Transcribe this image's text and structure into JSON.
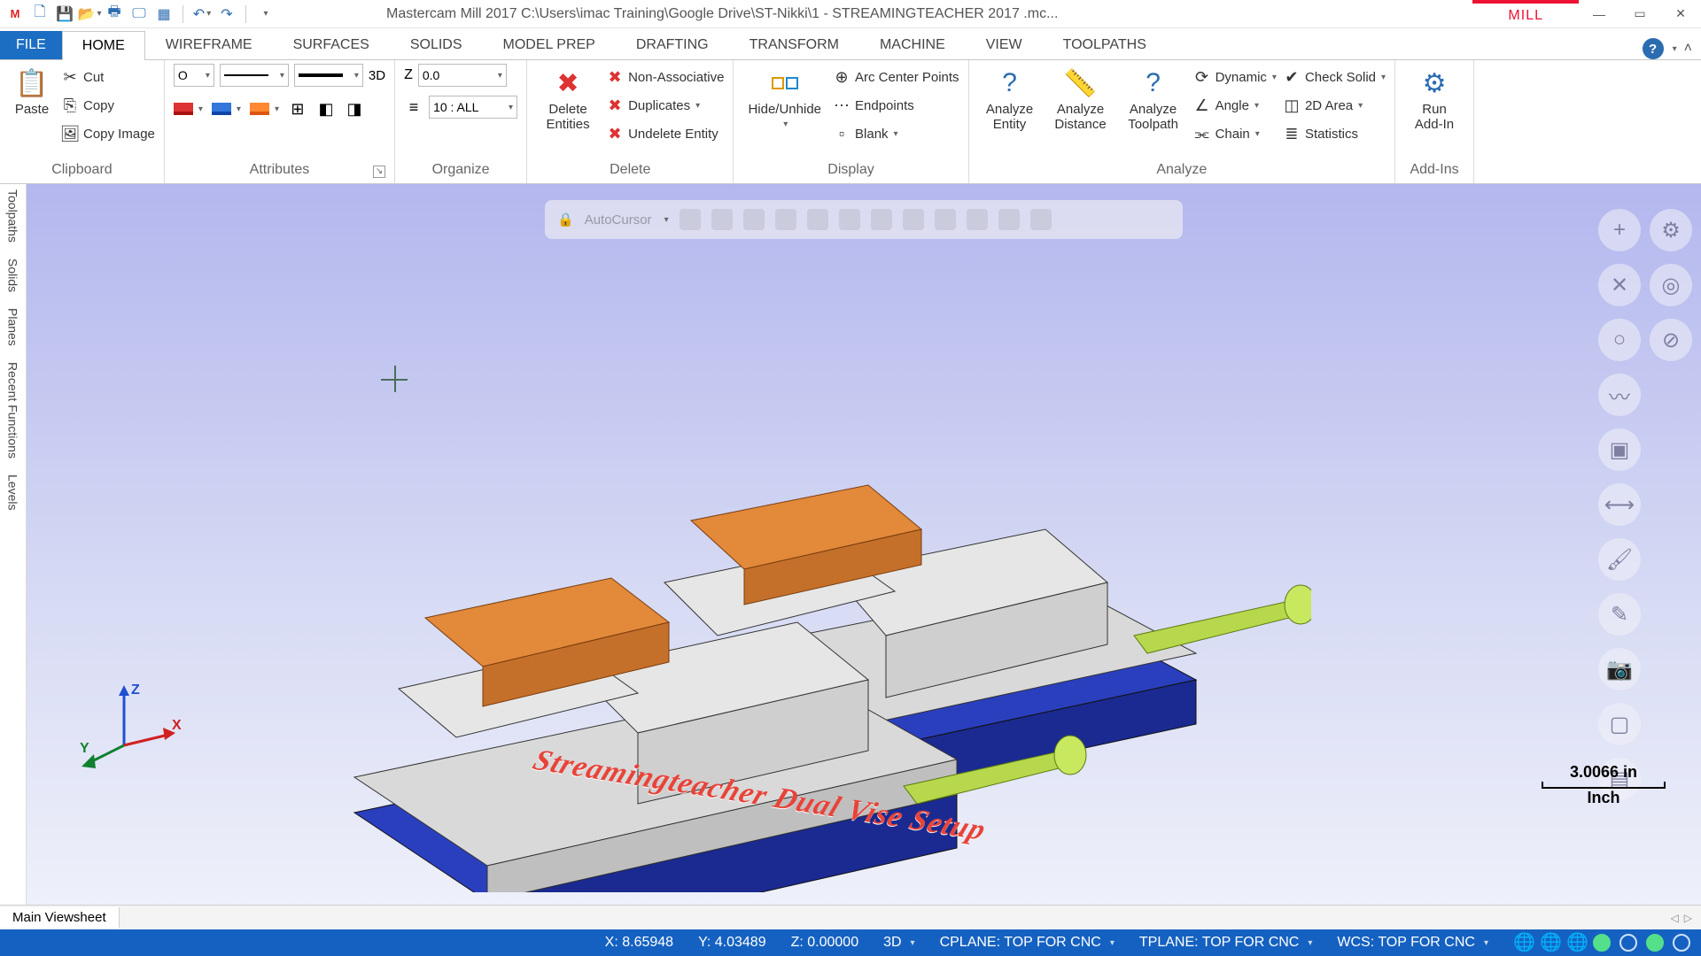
{
  "title": "Mastercam Mill 2017   C:\\Users\\imac Training\\Google Drive\\ST-Nikki\\1 - STREAMINGTEACHER 2017 .mc...",
  "context_tab": "MILL",
  "tabs": {
    "file": "FILE",
    "list": [
      "HOME",
      "WIREFRAME",
      "SURFACES",
      "SOLIDS",
      "MODEL PREP",
      "DRAFTING",
      "TRANSFORM",
      "MACHINE",
      "VIEW",
      "TOOLPATHS"
    ],
    "active": "HOME"
  },
  "ribbon": {
    "clipboard": {
      "label": "Clipboard",
      "paste": "Paste",
      "cut": "Cut",
      "copy": "Copy",
      "copy_image": "Copy Image"
    },
    "attributes": {
      "label": "Attributes",
      "point_style": "O",
      "threeD": "3D"
    },
    "organize": {
      "label": "Organize",
      "z_label": "Z",
      "z_value": "0.0",
      "level_value": "10 : ALL"
    },
    "delete": {
      "label": "Delete",
      "delete_entities": "Delete Entities",
      "non_assoc": "Non-Associative",
      "duplicates": "Duplicates",
      "undelete": "Undelete Entity"
    },
    "display": {
      "label": "Display",
      "hide_unhide": "Hide/Unhide",
      "arc_center": "Arc Center Points",
      "endpoints": "Endpoints",
      "blank": "Blank"
    },
    "analyze": {
      "label": "Analyze",
      "entity": "Analyze Entity",
      "distance": "Analyze Distance",
      "toolpath": "Analyze Toolpath",
      "dynamic": "Dynamic",
      "angle": "Angle",
      "chain": "Chain",
      "check_solid": "Check Solid",
      "area": "2D Area",
      "statistics": "Statistics"
    },
    "addins": {
      "label": "Add-Ins",
      "run": "Run Add-In"
    }
  },
  "side_tabs": [
    "Toolpaths",
    "Solids",
    "Planes",
    "Recent Functions",
    "Levels"
  ],
  "float_toolbar_label": "AutoCursor",
  "viewport": {
    "model_text": "Streamingteacher Dual Vise Setup",
    "axes": {
      "x": "X",
      "y": "Y",
      "z": "Z"
    },
    "scale_value": "3.0066 in",
    "scale_unit": "Inch"
  },
  "viewsheet_tab": "Main Viewsheet",
  "status": {
    "x": "X:   8.65948",
    "y": "Y:   4.03489",
    "z": "Z:   0.00000",
    "mode": "3D",
    "cplane": "CPLANE: TOP FOR CNC",
    "tplane": "TPLANE: TOP FOR CNC",
    "wcs": "WCS: TOP FOR CNC"
  }
}
